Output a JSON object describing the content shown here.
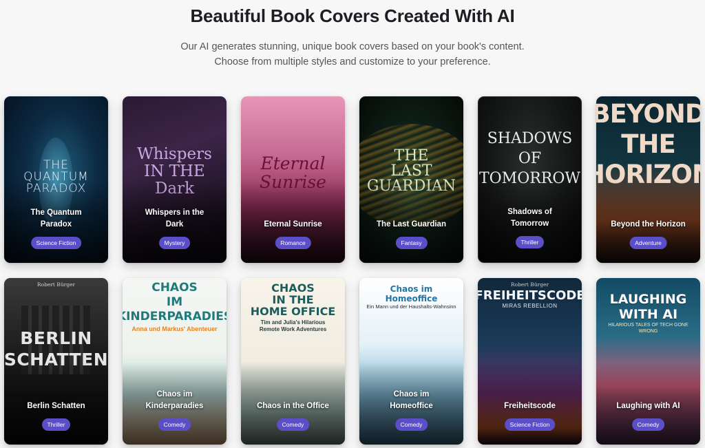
{
  "header": {
    "title": "Beautiful Book Covers Created With AI",
    "subtitle_line1": "Our AI generates stunning, unique book covers based on your book's content.",
    "subtitle_line2": "Choose from multiple styles and customize to your preference."
  },
  "cards": [
    {
      "art": "THE\nQUANTUM\nPARADOX",
      "author": "",
      "art_sub": "",
      "title": "The Quantum\nParadox",
      "genre": "Science Fiction"
    },
    {
      "art": "Whispers\nIN THE\nDark",
      "author": "",
      "art_sub": "",
      "title": "Whispers in the\nDark",
      "genre": "Mystery"
    },
    {
      "art": "Eternal\nSunrise",
      "author": "",
      "art_sub": "",
      "title": "Eternal Sunrise",
      "genre": "Romance"
    },
    {
      "art": "THE\nLAST\nGUARDIAN",
      "author": "",
      "art_sub": "",
      "title": "The Last Guardian",
      "genre": "Fantasy"
    },
    {
      "art": "SHADOWS\nOF\nTOMORROW",
      "author": "",
      "art_sub": "",
      "title": "Shadows of\nTomorrow",
      "genre": "Thriller"
    },
    {
      "art": "BEYOND\nTHE\nHORIZON",
      "author": "",
      "art_sub": "",
      "title": "Beyond the Horizon",
      "genre": "Adventure"
    },
    {
      "art": "BERLIN\nSCHATTEN",
      "author": "Robert Bürger",
      "art_sub": "",
      "title": "Berlin Schatten",
      "genre": "Thriller"
    },
    {
      "art": "CHAOS\nIM\nKINDERPARADIES",
      "author": "",
      "art_sub": "Anna und Markus' Abenteuer",
      "title": "Chaos im\nKinderparadies",
      "genre": "Comedy"
    },
    {
      "art": "CHAOS\nIN THE\nHOME OFFICE",
      "author": "",
      "art_sub": "Tim and Julia's Hilarious\nRemote Work Adventures",
      "title": "Chaos in the Office",
      "genre": "Comedy"
    },
    {
      "art": "Chaos im Homeoffice",
      "author": "",
      "art_sub": "Ein Mann und der Haushalts-Wahnsinn",
      "title": "Chaos im\nHomeoffice",
      "genre": "Comedy"
    },
    {
      "art": "FREIHEITSCODE",
      "author": "Robert Bürger",
      "art_sub": "MIRAS REBELLION",
      "title": "Freiheitscode",
      "genre": "Science Fiction"
    },
    {
      "art": "LAUGHING WITH AI",
      "author": "",
      "art_sub": "HILARIOUS TALES OF TECH GONE WRONG",
      "title": "Laughing with AI",
      "genre": "Comedy"
    }
  ]
}
